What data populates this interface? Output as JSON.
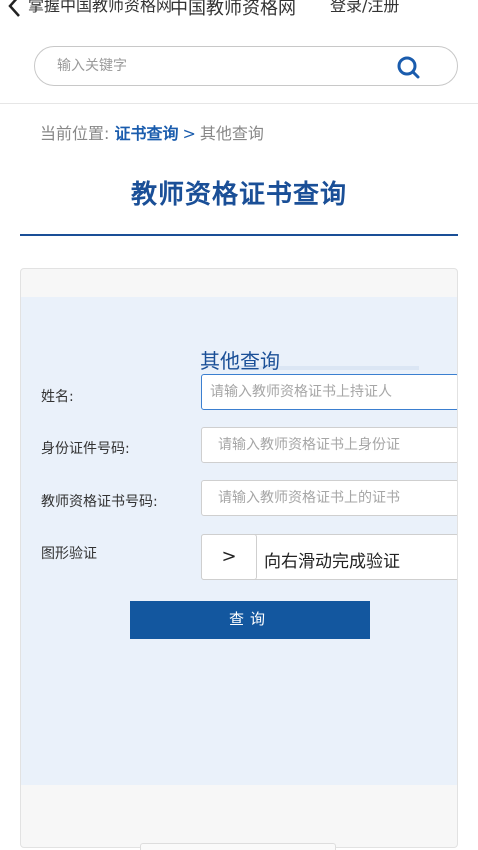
{
  "header": {
    "left_text": "掌握中国教师资格网",
    "title": "中国教师资格网",
    "right_text": "登录/注册"
  },
  "search": {
    "placeholder": "输入关键字"
  },
  "breadcrumb": {
    "prefix": "当前位置: ",
    "link": "证书查询",
    "separator": ">",
    "current": "其他查询"
  },
  "page_title": "教师资格证书查询",
  "form": {
    "section_title": "其他查询",
    "fields": [
      {
        "label": "姓名:",
        "placeholder": "请输入教师资格证书上持证人"
      },
      {
        "label": "身份证件号码:",
        "placeholder": "请输入教师资格证书上身份证"
      },
      {
        "label": "教师资格证书号码:",
        "placeholder": "请输入教师资格证书上的证书"
      }
    ],
    "captcha": {
      "label": "图形验证",
      "handle": ">",
      "hint": "向右滑动完成验证"
    },
    "submit_label": "查询"
  },
  "colors": {
    "brand": "#1a4f97",
    "button": "#13579f",
    "panel": "#eaf1fa"
  }
}
